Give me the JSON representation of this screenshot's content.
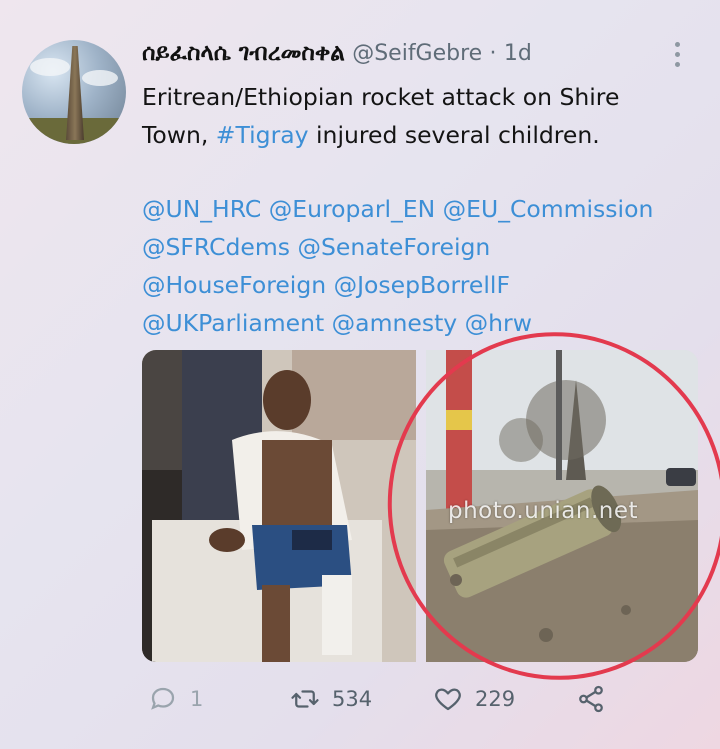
{
  "tweet": {
    "display_name": "ሰይፈስላሴ ገብረመስቀል",
    "handle": "@SeifGebre",
    "separator": "·",
    "time": "1d",
    "text_line1": "Eritrean/Ethiopian rocket attack on Shire",
    "text_line2_before": "Town, ",
    "hashtag": "#Tigray",
    "text_line2_after": " injured several children.",
    "mentions": [
      "@UN_HRC @Europarl_EN @EU_Commission",
      "@SFRCdems @SenateForeign",
      "@HouseForeign @JosepBorrellF",
      "@UKParliament @amnesty @hrw"
    ],
    "watermark": "photo.unian.net"
  },
  "actions": {
    "reply_count": "1",
    "retweet_count": "534",
    "like_count": "229"
  },
  "icons": {
    "reply": "reply-icon",
    "retweet": "retweet-icon",
    "like": "heart-icon",
    "share": "share-icon",
    "more": "more-vertical-icon"
  },
  "colors": {
    "link": "#3d8fd6",
    "annotation_circle": "#e33a4e"
  }
}
